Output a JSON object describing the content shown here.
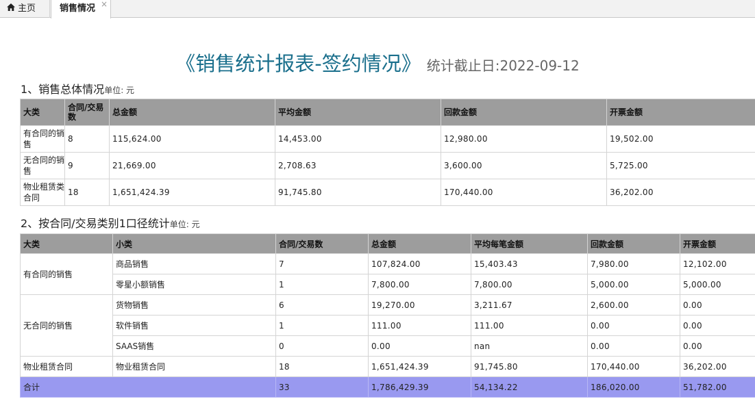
{
  "tabs": {
    "home": "主页",
    "active": "销售情况",
    "close": "×"
  },
  "title": {
    "main": "《销售统计报表-签约情况》",
    "sub": "统计截止日:2022-09-12"
  },
  "section1": {
    "heading": "1、销售总体情况",
    "unit": "单位: 元",
    "headers": [
      "大类",
      "合同/交易数",
      "总金额",
      "平均金额",
      "回款金额",
      "开票金额"
    ],
    "rows": [
      [
        "有合同的销售",
        "8",
        "115,624.00",
        "14,453.00",
        "12,980.00",
        "19,502.00"
      ],
      [
        "无合同的销售",
        "9",
        "21,669.00",
        "2,708.63",
        "3,600.00",
        "5,725.00"
      ],
      [
        "物业租赁类合同",
        "18",
        "1,651,424.39",
        "91,745.80",
        "170,440.00",
        "36,202.00"
      ]
    ]
  },
  "section2": {
    "heading": "2、按合同/交易类别1口径统计",
    "unit": "单位: 元",
    "headers": [
      "大类",
      "小类",
      "合同/交易数",
      "总金额",
      "平均每笔金额",
      "回款金额",
      "开票金额"
    ],
    "groups": [
      {
        "category": "有合同的销售",
        "rows": [
          [
            "商品销售",
            "7",
            "107,824.00",
            "15,403.43",
            "7,980.00",
            "12,102.00"
          ],
          [
            "零星小额销售",
            "1",
            "7,800.00",
            "7,800.00",
            "5,000.00",
            "5,000.00"
          ]
        ]
      },
      {
        "category": "无合同的销售",
        "rows": [
          [
            "货物销售",
            "6",
            "19,270.00",
            "3,211.67",
            "2,600.00",
            "0.00"
          ],
          [
            "软件销售",
            "1",
            "111.00",
            "111.00",
            "0.00",
            "0.00"
          ],
          [
            "SAAS销售",
            "0",
            "0.00",
            "nan",
            "0.00",
            "0.00"
          ]
        ]
      },
      {
        "category": "物业租赁合同",
        "rows": [
          [
            "物业租赁合同",
            "18",
            "1,651,424.39",
            "91,745.80",
            "170,440.00",
            "36,202.00"
          ]
        ]
      }
    ],
    "total": [
      "合计",
      "33",
      "1,786,429.39",
      "54,134.22",
      "186,020.00",
      "51,782.00"
    ]
  },
  "colors": {
    "title": "#1a6f8c",
    "header_bg": "#9d9d9d",
    "total_bg": "#9999f0"
  }
}
